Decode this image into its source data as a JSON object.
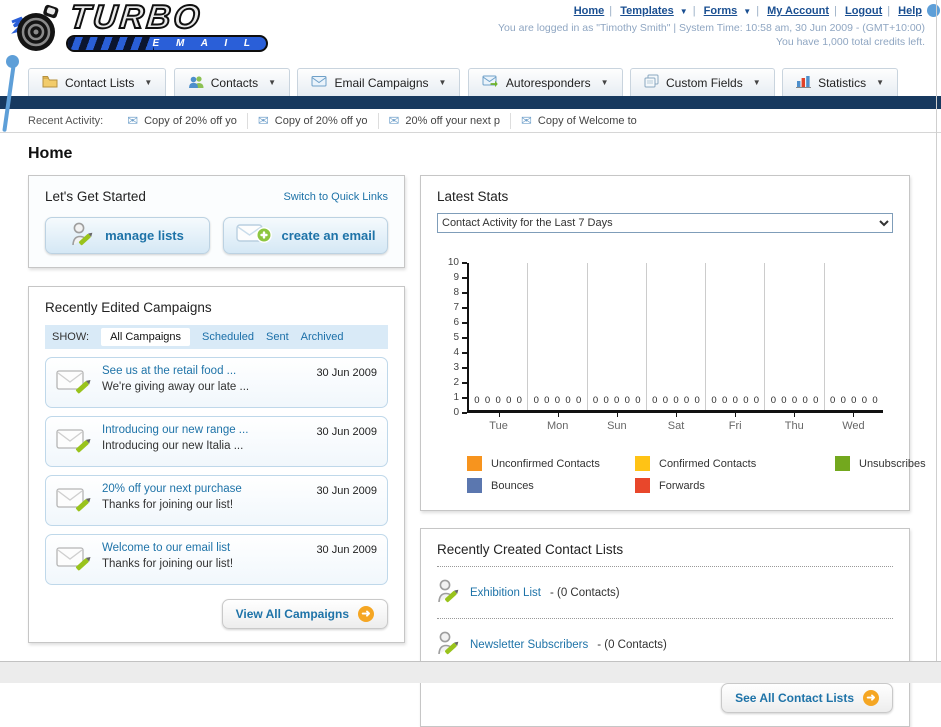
{
  "brand": {
    "name_top": "TURBO",
    "name_bottom": "E M A I L"
  },
  "header": {
    "links": [
      "Home",
      "Templates",
      "Forms",
      "My Account",
      "Logout",
      "Help"
    ],
    "login_info": "You are logged in as \"Timothy Smith\" | System Time: 10:58 am, 30 Jun 2009 - (GMT+10:00)",
    "credits": "You have 1,000 total credits left."
  },
  "nav": {
    "tabs": [
      {
        "label": "Contact Lists"
      },
      {
        "label": "Contacts"
      },
      {
        "label": "Email Campaigns"
      },
      {
        "label": "Autoresponders"
      },
      {
        "label": "Custom Fields"
      },
      {
        "label": "Statistics"
      }
    ]
  },
  "recent_activity": {
    "label": "Recent Activity:",
    "items": [
      "Copy of 20% off yo",
      "Copy of 20% off yo",
      "20% off your next p",
      "Copy of Welcome to"
    ]
  },
  "page": {
    "title": "Home"
  },
  "get_started": {
    "title": "Let's Get Started",
    "switch_link": "Switch to Quick Links",
    "buttons": [
      {
        "label": "manage lists"
      },
      {
        "label": "create an email"
      }
    ]
  },
  "campaigns": {
    "title": "Recently Edited Campaigns",
    "show_label": "SHOW:",
    "filters": [
      "All Campaigns",
      "Scheduled",
      "Sent",
      "Archived"
    ],
    "active_filter": "All Campaigns",
    "items": [
      {
        "title": "See us at the retail food ...",
        "subtitle": "We're giving away our late ...",
        "date": "30 Jun 2009"
      },
      {
        "title": "Introducing our new range ...",
        "subtitle": "Introducing our new Italia ...",
        "date": "30 Jun 2009"
      },
      {
        "title": "20% off your next purchase",
        "subtitle": "Thanks for joining our list!",
        "date": "30 Jun 2009"
      },
      {
        "title": "Welcome to our email list",
        "subtitle": "Thanks for joining our list!",
        "date": "30 Jun 2009"
      }
    ],
    "view_all_label": "View All Campaigns"
  },
  "stats": {
    "title": "Latest Stats",
    "selected_option": "Contact Activity for the Last 7 Days",
    "chart_data": {
      "type": "bar",
      "title": "Contact Activity for the Last 7 Days",
      "categories": [
        "Tue",
        "Mon",
        "Sun",
        "Sat",
        "Fri",
        "Thu",
        "Wed"
      ],
      "series": [
        {
          "name": "Unconfirmed Contacts",
          "color": "#F7941E",
          "values": [
            0,
            0,
            0,
            0,
            0,
            0,
            0
          ]
        },
        {
          "name": "Confirmed Contacts",
          "color": "#FFC315",
          "values": [
            0,
            0,
            0,
            0,
            0,
            0,
            0
          ]
        },
        {
          "name": "Unsubscribes",
          "color": "#73A81E",
          "values": [
            0,
            0,
            0,
            0,
            0,
            0,
            0
          ]
        },
        {
          "name": "Bounces",
          "color": "#5B77AF",
          "values": [
            0,
            0,
            0,
            0,
            0,
            0,
            0
          ]
        },
        {
          "name": "Forwards",
          "color": "#E8472B",
          "values": [
            0,
            0,
            0,
            0,
            0,
            0,
            0
          ]
        }
      ],
      "xlabel": "",
      "ylabel": "",
      "ylim": [
        0,
        10
      ],
      "yticks": [
        0,
        1,
        2,
        3,
        4,
        5,
        6,
        7,
        8,
        9,
        10
      ],
      "grid": "vertical",
      "value_labels_shown": true,
      "legend_position": "bottom"
    }
  },
  "contact_lists": {
    "title": "Recently Created Contact Lists",
    "items": [
      {
        "name": "Exhibition List",
        "detail": "- (0 Contacts)"
      },
      {
        "name": "Newsletter Subscribers",
        "detail": "- (0 Contacts)"
      }
    ],
    "see_all_label": "See All Contact Lists"
  },
  "colors": {
    "navy_bar": "#17395F",
    "link_blue": "#1E73A8",
    "header_link_blue": "#1A4F91",
    "login_muted": "#8FA6C2",
    "show_bar_bg": "#D9EAF7",
    "button_arrow_orange": "#F5A623",
    "deco_blue": "#5E9FD8",
    "logo_blue": "#2A5FD8",
    "pencil_green": "#99C31C"
  }
}
